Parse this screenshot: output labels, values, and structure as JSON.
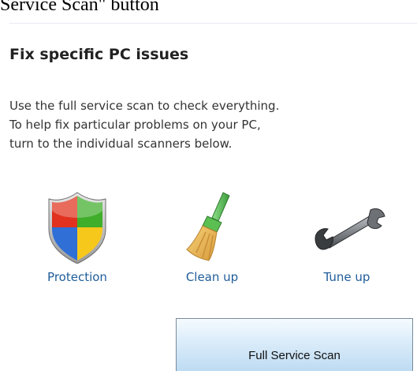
{
  "caption": "Service Scan\" button",
  "panel": {
    "title": "Fix specific PC issues",
    "description_lines": [
      "Use the full service scan to check everything.",
      "To help fix particular problems on your PC,",
      "turn to the individual scanners below."
    ]
  },
  "tools": [
    {
      "label": "Protection",
      "icon": "shield-icon"
    },
    {
      "label": "Clean up",
      "icon": "broom-icon"
    },
    {
      "label": "Tune up",
      "icon": "wrench-icon"
    }
  ],
  "scan_button": {
    "label": "Full Service Scan"
  },
  "colors": {
    "link": "#1f5c99",
    "title": "#222222",
    "button_gradient_top": "#f5fbff",
    "button_gradient_bottom": "#bcdaf2"
  }
}
